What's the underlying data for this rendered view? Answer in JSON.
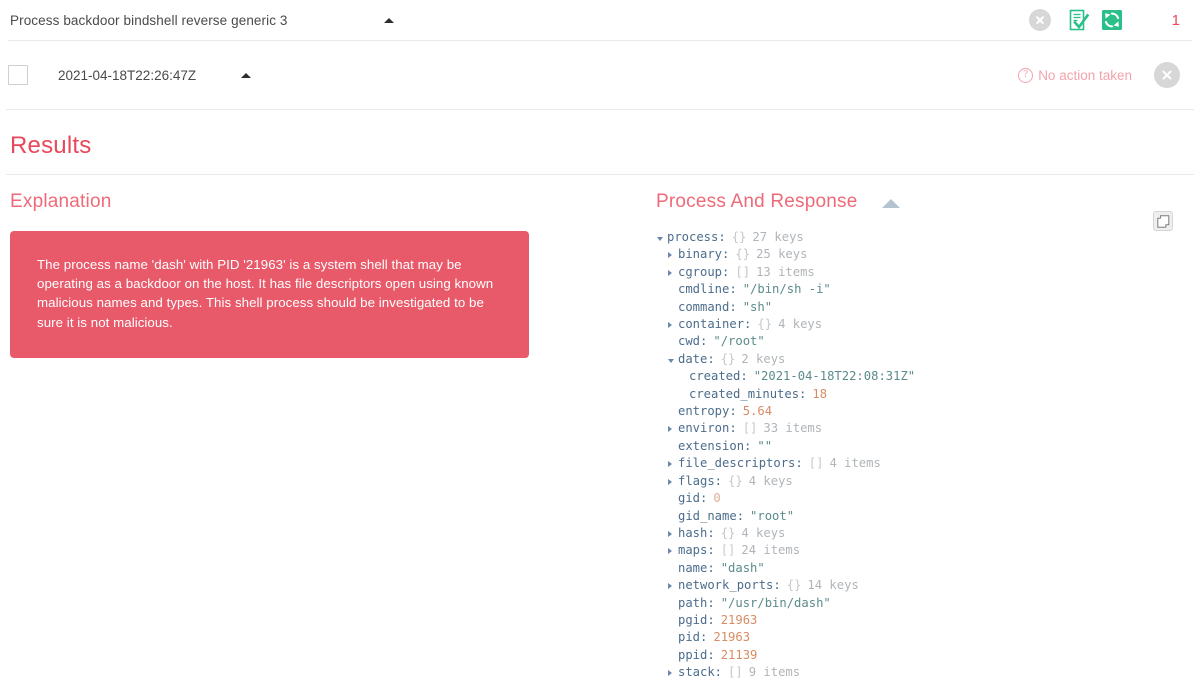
{
  "alert": {
    "title": "Process backdoor bindshell reverse generic 3",
    "collapse_icon": "caret-up-icon",
    "dismiss_icon": "close-circle-icon",
    "checklist_icon": "checklist-icon",
    "refresh_icon": "refresh-icon",
    "count": "1",
    "count_color": "#e8485a"
  },
  "event": {
    "timestamp": "2021-04-18T22:26:47Z",
    "collapse_icon": "caret-up-icon",
    "status_label": "No action taken",
    "status_icon": "question-circle-icon",
    "status_color": "#f2a3ab",
    "dismiss_icon": "close-circle-icon",
    "checkbox_checked": false
  },
  "results": {
    "heading": "Results"
  },
  "explanation": {
    "heading": "Explanation",
    "body": "The process name 'dash' with PID '21963' is a system shell that may be operating as a backdoor on the host. It has file descriptors open using known malicious names and types. This shell process should be investigated to be sure it is not malicious.",
    "box_color": "#e8596a"
  },
  "process_and_response": {
    "heading": "Process And Response",
    "collapse_icon": "caret-up-icon",
    "copy_icon": "copy-icon",
    "tree": [
      {
        "indent": 1,
        "toggle": "open",
        "key": "process",
        "meta": "{}",
        "count": "27 keys"
      },
      {
        "indent": 2,
        "toggle": "closed",
        "key": "binary",
        "meta": "{}",
        "count": "25 keys"
      },
      {
        "indent": 2,
        "toggle": "closed",
        "key": "cgroup",
        "meta": "[]",
        "count": "13 items"
      },
      {
        "indent": 2,
        "toggle": "none",
        "key": "cmdline",
        "value": "\"/bin/sh -i\"",
        "vtype": "string"
      },
      {
        "indent": 2,
        "toggle": "none",
        "key": "command",
        "value": "\"sh\"",
        "vtype": "string"
      },
      {
        "indent": 2,
        "toggle": "closed",
        "key": "container",
        "meta": "{}",
        "count": "4 keys"
      },
      {
        "indent": 2,
        "toggle": "none",
        "key": "cwd",
        "value": "\"/root\"",
        "vtype": "string"
      },
      {
        "indent": 2,
        "toggle": "open",
        "key": "date",
        "meta": "{}",
        "count": "2 keys"
      },
      {
        "indent": 3,
        "toggle": "none",
        "key": "created",
        "value": "\"2021-04-18T22:08:31Z\"",
        "vtype": "string"
      },
      {
        "indent": 3,
        "toggle": "none",
        "key": "created_minutes",
        "value": "18",
        "vtype": "number"
      },
      {
        "indent": 2,
        "toggle": "none",
        "key": "entropy",
        "value": "5.64",
        "vtype": "number"
      },
      {
        "indent": 2,
        "toggle": "closed",
        "key": "environ",
        "meta": "[]",
        "count": "33 items"
      },
      {
        "indent": 2,
        "toggle": "none",
        "key": "extension",
        "value": "\"\"",
        "vtype": "string"
      },
      {
        "indent": 2,
        "toggle": "closed",
        "key": "file_descriptors",
        "meta": "[]",
        "count": "4 items"
      },
      {
        "indent": 2,
        "toggle": "closed",
        "key": "flags",
        "meta": "{}",
        "count": "4 keys"
      },
      {
        "indent": 2,
        "toggle": "none",
        "key": "gid",
        "value": "0",
        "vtype": "zero"
      },
      {
        "indent": 2,
        "toggle": "none",
        "key": "gid_name",
        "value": "\"root\"",
        "vtype": "string"
      },
      {
        "indent": 2,
        "toggle": "closed",
        "key": "hash",
        "meta": "{}",
        "count": "4 keys"
      },
      {
        "indent": 2,
        "toggle": "closed",
        "key": "maps",
        "meta": "[]",
        "count": "24 items"
      },
      {
        "indent": 2,
        "toggle": "none",
        "key": "name",
        "value": "\"dash\"",
        "vtype": "string"
      },
      {
        "indent": 2,
        "toggle": "closed",
        "key": "network_ports",
        "meta": "{}",
        "count": "14 keys"
      },
      {
        "indent": 2,
        "toggle": "none",
        "key": "path",
        "value": "\"/usr/bin/dash\"",
        "vtype": "string"
      },
      {
        "indent": 2,
        "toggle": "none",
        "key": "pgid",
        "value": "21963",
        "vtype": "number"
      },
      {
        "indent": 2,
        "toggle": "none",
        "key": "pid",
        "value": "21963",
        "vtype": "number"
      },
      {
        "indent": 2,
        "toggle": "none",
        "key": "ppid",
        "value": "21139",
        "vtype": "number"
      },
      {
        "indent": 2,
        "toggle": "closed",
        "key": "stack",
        "meta": "[]",
        "count": "9 items"
      }
    ]
  }
}
